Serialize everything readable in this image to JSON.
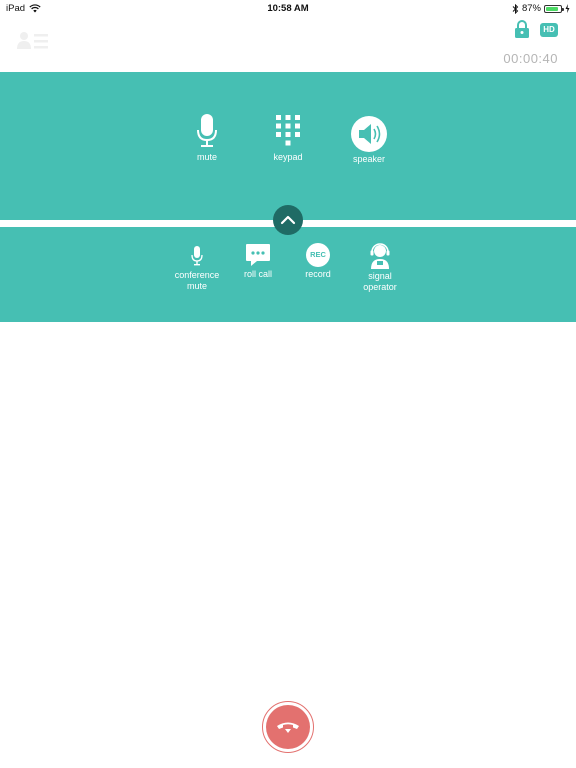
{
  "status_bar": {
    "device": "iPad",
    "time": "10:58 AM",
    "battery_percent": "87%",
    "battery_level": 0.87
  },
  "header": {
    "hd_label": "HD",
    "call_timer": "00:00:40"
  },
  "controls_primary": [
    {
      "label": "mute"
    },
    {
      "label": "keypad"
    },
    {
      "label": "speaker"
    }
  ],
  "controls_secondary": [
    {
      "label": "conference\nmute"
    },
    {
      "label": "roll call"
    },
    {
      "label": "record",
      "icon_text": "REC"
    },
    {
      "label": "signal\noperator"
    }
  ],
  "colors": {
    "accent": "#46bfb3",
    "accent_dark": "#1f6b65",
    "hangup": "#e3716f",
    "timer": "#b5b5b5"
  },
  "icons": {
    "contacts": "contacts-list-icon",
    "lock": "lock-icon",
    "mute": "microphone-icon",
    "keypad": "keypad-grid-icon",
    "speaker": "speaker-icon",
    "conference_mute": "small-microphone-icon",
    "roll_call": "chat-bubble-icon",
    "record": "rec-icon",
    "signal_operator": "headset-operator-icon",
    "collapse": "chevron-up-icon",
    "hangup": "phone-hangup-icon"
  }
}
